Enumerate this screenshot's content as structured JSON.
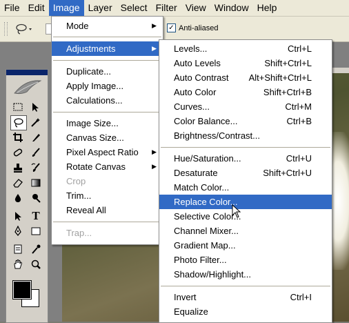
{
  "menubar": {
    "items": [
      "File",
      "Edit",
      "Image",
      "Layer",
      "Select",
      "Filter",
      "View",
      "Window",
      "Help"
    ],
    "active": "Image"
  },
  "options_bar": {
    "anti_aliased_label": "Anti-aliased",
    "anti_aliased_checked": true
  },
  "image_menu": [
    {
      "label": "Mode",
      "submenu": true
    },
    {
      "label": "Adjustments",
      "submenu": true,
      "highlighted": true
    },
    {
      "label": "Duplicate..."
    },
    {
      "label": "Apply Image..."
    },
    {
      "label": "Calculations..."
    },
    {
      "label": "Image Size..."
    },
    {
      "label": "Canvas Size..."
    },
    {
      "label": "Pixel Aspect Ratio",
      "submenu": true
    },
    {
      "label": "Rotate Canvas",
      "submenu": true
    },
    {
      "label": "Crop",
      "disabled": true
    },
    {
      "label": "Trim..."
    },
    {
      "label": "Reveal All"
    },
    {
      "label": "Trap...",
      "disabled": true
    }
  ],
  "adjustments_menu": [
    {
      "label": "Levels...",
      "shortcut": "Ctrl+L"
    },
    {
      "label": "Auto Levels",
      "shortcut": "Shift+Ctrl+L"
    },
    {
      "label": "Auto Contrast",
      "shortcut": "Alt+Shift+Ctrl+L"
    },
    {
      "label": "Auto Color",
      "shortcut": "Shift+Ctrl+B"
    },
    {
      "label": "Curves...",
      "shortcut": "Ctrl+M"
    },
    {
      "label": "Color Balance...",
      "shortcut": "Ctrl+B"
    },
    {
      "label": "Brightness/Contrast...",
      "shortcut": ""
    },
    {
      "label": "Hue/Saturation...",
      "shortcut": "Ctrl+U"
    },
    {
      "label": "Desaturate",
      "shortcut": "Shift+Ctrl+U"
    },
    {
      "label": "Match Color...",
      "shortcut": ""
    },
    {
      "label": "Replace Color...",
      "shortcut": "",
      "highlighted": true
    },
    {
      "label": "Selective Color...",
      "shortcut": ""
    },
    {
      "label": "Channel Mixer...",
      "shortcut": ""
    },
    {
      "label": "Gradient Map...",
      "shortcut": ""
    },
    {
      "label": "Photo Filter...",
      "shortcut": ""
    },
    {
      "label": "Shadow/Highlight...",
      "shortcut": ""
    },
    {
      "label": "Invert",
      "shortcut": "Ctrl+I"
    },
    {
      "label": "Equalize",
      "shortcut": ""
    }
  ],
  "colors": {
    "highlight": "#316ac5",
    "menubar_bg": "#ece9d8",
    "disabled_text": "#a0a0a0"
  }
}
